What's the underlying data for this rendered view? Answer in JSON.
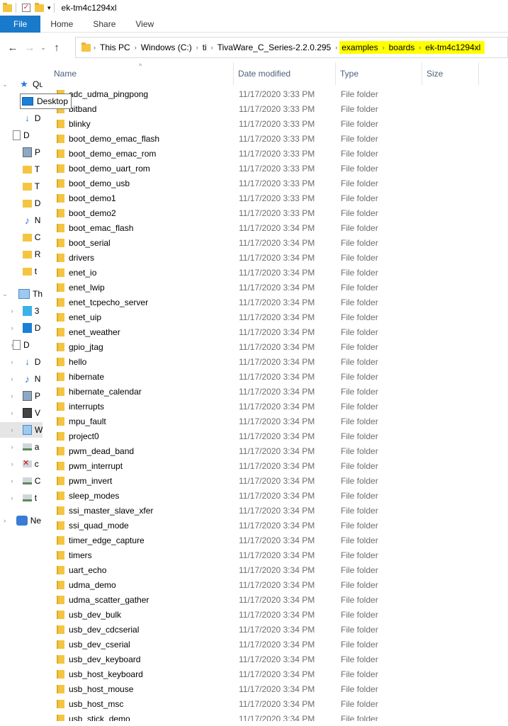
{
  "window": {
    "title": "ek-tm4c1294xl"
  },
  "ribbon": {
    "tabs": [
      "File",
      "Home",
      "Share",
      "View"
    ]
  },
  "address": {
    "crumbs": [
      "This PC",
      "Windows (C:)",
      "ti",
      "TivaWare_C_Series-2.2.0.295"
    ],
    "highlighted_crumbs": [
      "examples",
      "boards",
      "ek-tm4c1294xl"
    ]
  },
  "navpane": {
    "quick_access_label": "Qu",
    "desktop_tooltip": "Desktop",
    "this_pc_label": "Th",
    "network_label": "Ne",
    "items": [
      {
        "icon": "download-icon",
        "lbl": "D"
      },
      {
        "icon": "document-icon",
        "lbl": "D"
      },
      {
        "icon": "picture-icon",
        "lbl": "P"
      },
      {
        "icon": "folder-icon",
        "lbl": "T"
      },
      {
        "icon": "folder-icon",
        "lbl": "T"
      },
      {
        "icon": "folder-icon",
        "lbl": "D"
      },
      {
        "icon": "music-icon",
        "lbl": "N"
      },
      {
        "icon": "folder-icon",
        "lbl": "C"
      },
      {
        "icon": "folder-icon",
        "lbl": "R"
      },
      {
        "icon": "folder-icon",
        "lbl": "t"
      }
    ],
    "pc_items": [
      {
        "icon": "3d-objects-icon",
        "lbl": "3"
      },
      {
        "icon": "desktop-icon",
        "lbl": "D"
      },
      {
        "icon": "document-icon",
        "lbl": "D"
      },
      {
        "icon": "download-icon",
        "lbl": "D"
      },
      {
        "icon": "music-icon",
        "lbl": "N"
      },
      {
        "icon": "picture-icon",
        "lbl": "P"
      },
      {
        "icon": "video-icon",
        "lbl": "V"
      },
      {
        "icon": "windows-drive-icon",
        "lbl": "W"
      },
      {
        "icon": "drive-icon",
        "lbl": "a"
      },
      {
        "icon": "disconnected-drive-icon",
        "lbl": "c"
      },
      {
        "icon": "drive-icon",
        "lbl": "C"
      },
      {
        "icon": "drive-icon",
        "lbl": "t"
      }
    ]
  },
  "columns": {
    "name": "Name",
    "date": "Date modified",
    "type": "Type",
    "size": "Size"
  },
  "files": [
    {
      "name": "adc_udma_pingpong",
      "date": "11/17/2020 3:33 PM",
      "type": "File folder"
    },
    {
      "name": "bitband",
      "date": "11/17/2020 3:33 PM",
      "type": "File folder"
    },
    {
      "name": "blinky",
      "date": "11/17/2020 3:33 PM",
      "type": "File folder"
    },
    {
      "name": "boot_demo_emac_flash",
      "date": "11/17/2020 3:33 PM",
      "type": "File folder"
    },
    {
      "name": "boot_demo_emac_rom",
      "date": "11/17/2020 3:33 PM",
      "type": "File folder"
    },
    {
      "name": "boot_demo_uart_rom",
      "date": "11/17/2020 3:33 PM",
      "type": "File folder"
    },
    {
      "name": "boot_demo_usb",
      "date": "11/17/2020 3:33 PM",
      "type": "File folder"
    },
    {
      "name": "boot_demo1",
      "date": "11/17/2020 3:33 PM",
      "type": "File folder"
    },
    {
      "name": "boot_demo2",
      "date": "11/17/2020 3:33 PM",
      "type": "File folder"
    },
    {
      "name": "boot_emac_flash",
      "date": "11/17/2020 3:34 PM",
      "type": "File folder"
    },
    {
      "name": "boot_serial",
      "date": "11/17/2020 3:34 PM",
      "type": "File folder"
    },
    {
      "name": "drivers",
      "date": "11/17/2020 3:34 PM",
      "type": "File folder"
    },
    {
      "name": "enet_io",
      "date": "11/17/2020 3:34 PM",
      "type": "File folder"
    },
    {
      "name": "enet_lwip",
      "date": "11/17/2020 3:34 PM",
      "type": "File folder"
    },
    {
      "name": "enet_tcpecho_server",
      "date": "11/17/2020 3:34 PM",
      "type": "File folder"
    },
    {
      "name": "enet_uip",
      "date": "11/17/2020 3:34 PM",
      "type": "File folder"
    },
    {
      "name": "enet_weather",
      "date": "11/17/2020 3:34 PM",
      "type": "File folder"
    },
    {
      "name": "gpio_jtag",
      "date": "11/17/2020 3:34 PM",
      "type": "File folder"
    },
    {
      "name": "hello",
      "date": "11/17/2020 3:34 PM",
      "type": "File folder"
    },
    {
      "name": "hibernate",
      "date": "11/17/2020 3:34 PM",
      "type": "File folder"
    },
    {
      "name": "hibernate_calendar",
      "date": "11/17/2020 3:34 PM",
      "type": "File folder"
    },
    {
      "name": "interrupts",
      "date": "11/17/2020 3:34 PM",
      "type": "File folder"
    },
    {
      "name": "mpu_fault",
      "date": "11/17/2020 3:34 PM",
      "type": "File folder"
    },
    {
      "name": "project0",
      "date": "11/17/2020 3:34 PM",
      "type": "File folder"
    },
    {
      "name": "pwm_dead_band",
      "date": "11/17/2020 3:34 PM",
      "type": "File folder"
    },
    {
      "name": "pwm_interrupt",
      "date": "11/17/2020 3:34 PM",
      "type": "File folder"
    },
    {
      "name": "pwm_invert",
      "date": "11/17/2020 3:34 PM",
      "type": "File folder"
    },
    {
      "name": "sleep_modes",
      "date": "11/17/2020 3:34 PM",
      "type": "File folder"
    },
    {
      "name": "ssi_master_slave_xfer",
      "date": "11/17/2020 3:34 PM",
      "type": "File folder"
    },
    {
      "name": "ssi_quad_mode",
      "date": "11/17/2020 3:34 PM",
      "type": "File folder"
    },
    {
      "name": "timer_edge_capture",
      "date": "11/17/2020 3:34 PM",
      "type": "File folder"
    },
    {
      "name": "timers",
      "date": "11/17/2020 3:34 PM",
      "type": "File folder"
    },
    {
      "name": "uart_echo",
      "date": "11/17/2020 3:34 PM",
      "type": "File folder"
    },
    {
      "name": "udma_demo",
      "date": "11/17/2020 3:34 PM",
      "type": "File folder"
    },
    {
      "name": "udma_scatter_gather",
      "date": "11/17/2020 3:34 PM",
      "type": "File folder"
    },
    {
      "name": "usb_dev_bulk",
      "date": "11/17/2020 3:34 PM",
      "type": "File folder"
    },
    {
      "name": "usb_dev_cdcserial",
      "date": "11/17/2020 3:34 PM",
      "type": "File folder"
    },
    {
      "name": "usb_dev_cserial",
      "date": "11/17/2020 3:34 PM",
      "type": "File folder"
    },
    {
      "name": "usb_dev_keyboard",
      "date": "11/17/2020 3:34 PM",
      "type": "File folder"
    },
    {
      "name": "usb_host_keyboard",
      "date": "11/17/2020 3:34 PM",
      "type": "File folder"
    },
    {
      "name": "usb_host_mouse",
      "date": "11/17/2020 3:34 PM",
      "type": "File folder"
    },
    {
      "name": "usb_host_msc",
      "date": "11/17/2020 3:34 PM",
      "type": "File folder"
    },
    {
      "name": "usb_stick_demo",
      "date": "11/17/2020 3:34 PM",
      "type": "File folder"
    }
  ],
  "colors": {
    "file_tab": "#1979ca",
    "highlight": "#ffff00",
    "header_text": "#4c607a",
    "folder": "#f4c542"
  }
}
